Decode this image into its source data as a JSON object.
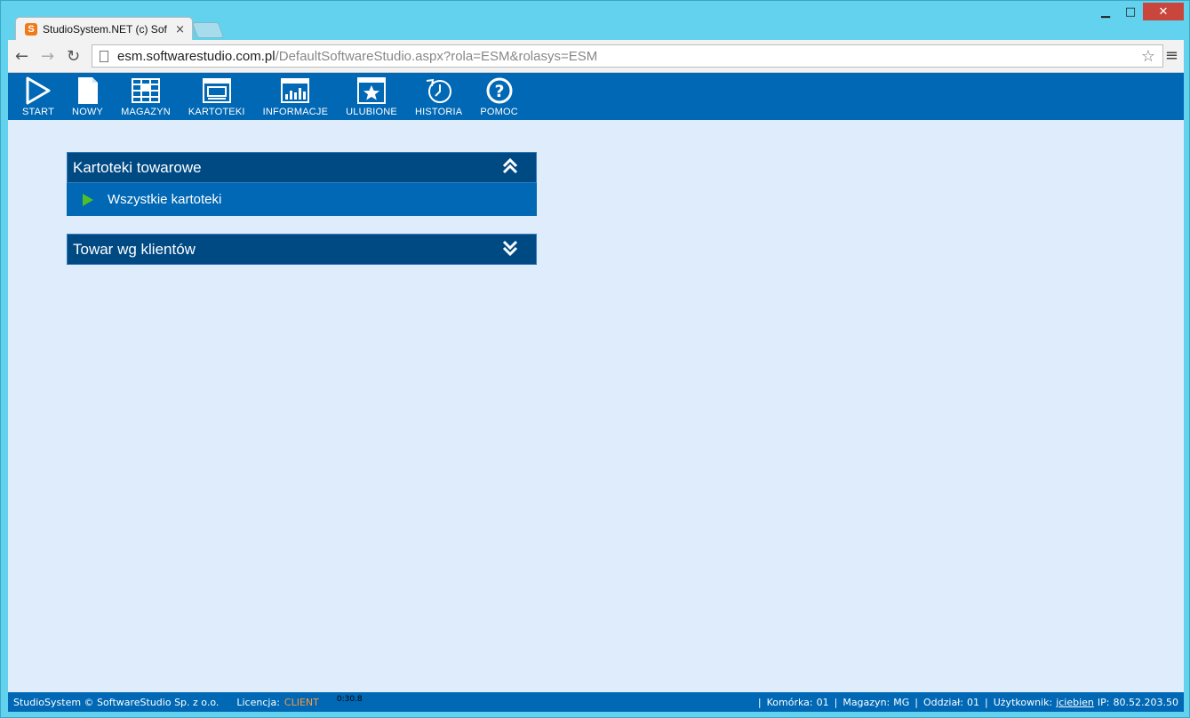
{
  "browser": {
    "tab_title": "StudioSystem.NET (c) Soft",
    "favicon_letter": "S",
    "url_host": "esm.softwarestudio.com.pl",
    "url_path": "/DefaultSoftwareStudio.aspx?rola=ESM&rolasys=ESM",
    "min_glyph": "▁",
    "max_glyph": "□",
    "close_glyph": "✕",
    "tab_close_glyph": "×",
    "back_glyph": "←",
    "forward_glyph": "→",
    "reload_glyph": "↻",
    "star_glyph": "☆",
    "menu_glyph": "≡"
  },
  "nav": {
    "items": [
      {
        "label": "START",
        "icon": "play-icon"
      },
      {
        "label": "NOWY",
        "icon": "new-document-icon"
      },
      {
        "label": "MAGAZYN",
        "icon": "warehouse-grid-icon"
      },
      {
        "label": "KARTOTEKI",
        "icon": "card-window-icon"
      },
      {
        "label": "INFORMACJE",
        "icon": "chart-window-icon"
      },
      {
        "label": "ULUBIONE",
        "icon": "star-window-icon"
      },
      {
        "label": "HISTORIA",
        "icon": "history-icon"
      },
      {
        "label": "POMOC",
        "icon": "help-icon"
      }
    ]
  },
  "panels": [
    {
      "title": "Kartoteki towarowe",
      "expanded": true,
      "items": [
        "Wszystkie kartoteki"
      ]
    },
    {
      "title": "Towar wg klientów",
      "expanded": false,
      "items": []
    }
  ],
  "status": {
    "copyright": "StudioSystem © SoftwareStudio Sp. z o.o.",
    "licence_label": "Licencja:",
    "licence_value": "CLIENT",
    "timer": "0:30.8",
    "cell_label": "Komórka:",
    "cell_value": "01",
    "warehouse_label": "Magazyn:",
    "warehouse_value": "MG",
    "branch_label": "Oddział:",
    "branch_value": "01",
    "user_label": "Użytkownik:",
    "user_value": "jciebien",
    "ip_label": "IP:",
    "ip_value": "80.52.203.50"
  },
  "colors": {
    "nav_bg": "#0068b4",
    "panel_head_bg": "#004a84",
    "page_bg": "#dfecfb",
    "licence_accent": "#ff9a3c"
  }
}
